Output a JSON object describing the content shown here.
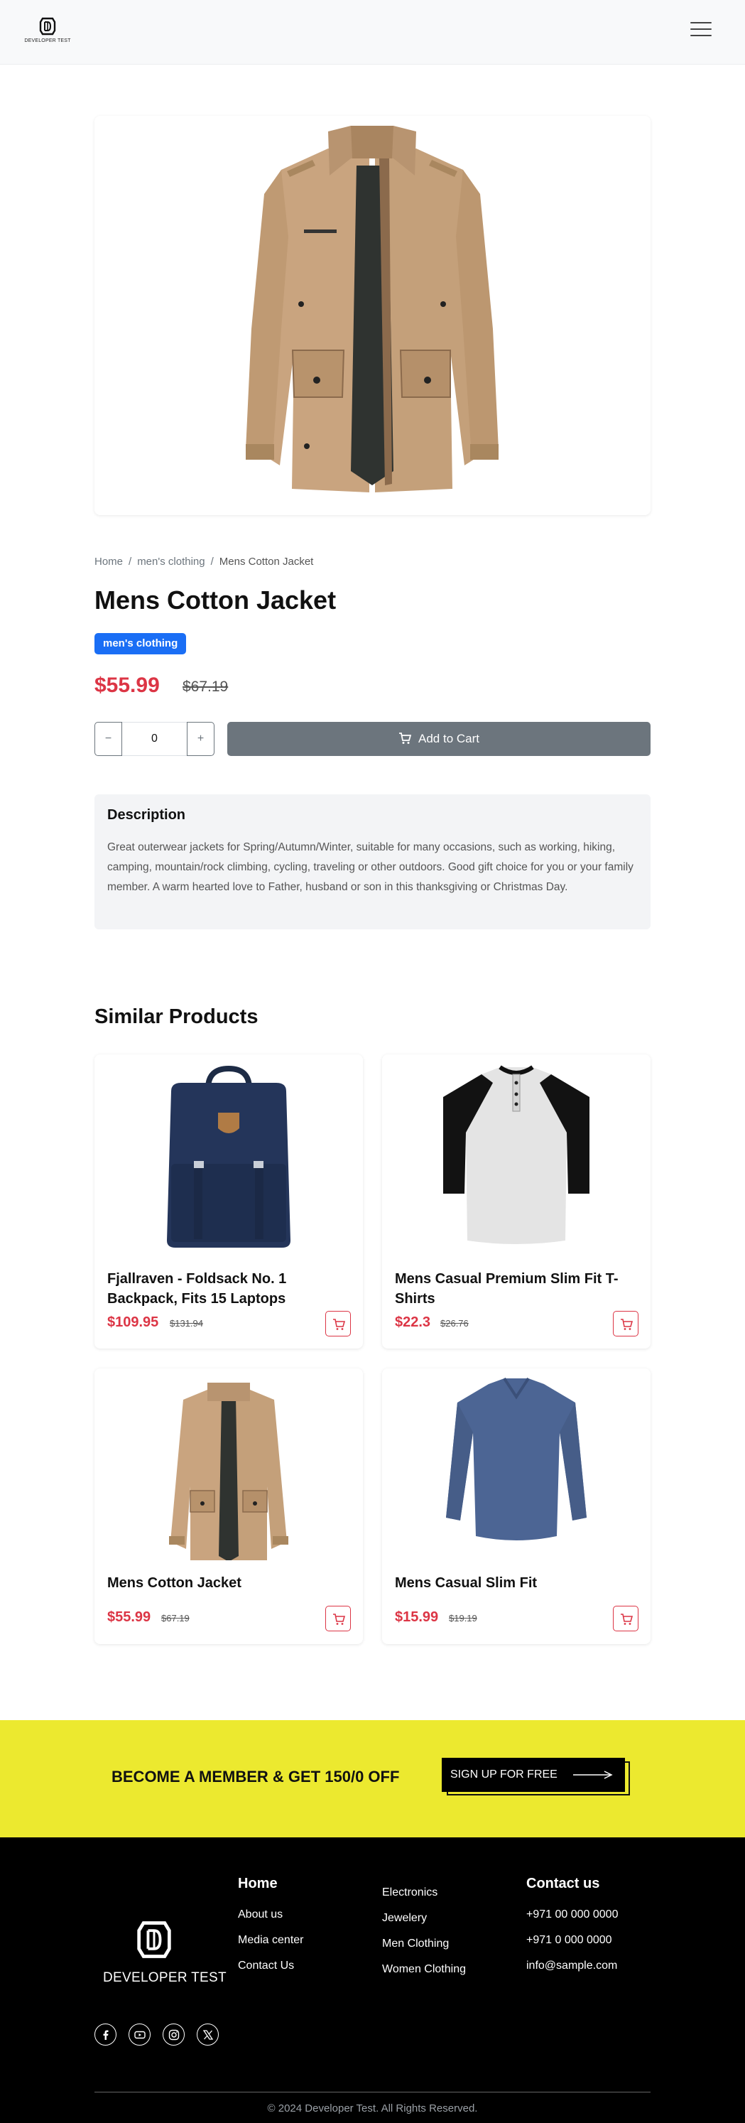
{
  "header": {
    "logo_text": "DEVELOPER TEST"
  },
  "breadcrumb": {
    "home": "Home",
    "category": "men's clothing",
    "current": "Mens Cotton Jacket"
  },
  "product": {
    "title": "Mens Cotton Jacket",
    "category_badge": "men's clothing",
    "price": "$55.99",
    "old_price": "$67.19",
    "quantity": "0",
    "minus_label": "−",
    "plus_label": "+",
    "add_to_cart_label": "Add to Cart",
    "description_heading": "Description",
    "description": "Great outerwear jackets for Spring/Autumn/Winter, suitable for many occasions, such as working, hiking, camping, mountain/rock climbing, cycling, traveling or other outdoors. Good gift choice for you or your family member. A warm hearted love to Father, husband or son in this thanksgiving or Christmas Day."
  },
  "similar": {
    "heading": "Similar Products",
    "items": [
      {
        "title": "Fjallraven - Foldsack No. 1 Backpack, Fits 15 Laptops",
        "price": "$109.95",
        "old_price": "$131.94",
        "image": "backpack"
      },
      {
        "title": "Mens Casual Premium Slim Fit T-Shirts",
        "price": "$22.3",
        "old_price": "$26.76",
        "image": "raglan-tshirt"
      },
      {
        "title": "Mens Cotton Jacket",
        "price": "$55.99",
        "old_price": "$67.19",
        "image": "cotton-jacket"
      },
      {
        "title": "Mens Casual Slim Fit",
        "price": "$15.99",
        "old_price": "$19.19",
        "image": "longsleeve-tshirt"
      }
    ]
  },
  "banner": {
    "text": "BECOME A MEMBER & GET 150/0 OFF",
    "button_label": "SIGN UP FOR FREE"
  },
  "footer": {
    "logo_text": "DEVELOPER TEST",
    "col1": {
      "heading": "Home",
      "links": [
        "About us",
        "Media center",
        "Contact Us"
      ]
    },
    "col2": {
      "links": [
        "Electronics",
        "Jewelery",
        "Men Clothing",
        "Women Clothing"
      ]
    },
    "col3": {
      "heading": "Contact us",
      "links": [
        "+971 00 000 0000",
        "+971 0 000 0000",
        "info@sample.com"
      ]
    },
    "socials": [
      "facebook-icon",
      "youtube-icon",
      "instagram-icon",
      "x-icon"
    ],
    "copyright": "© 2024 Developer Test. All Rights Reserved."
  },
  "colors": {
    "accent_red": "#dc3545",
    "badge_blue": "#1a6ef5",
    "banner_yellow": "#ece92f",
    "button_gray": "#6c757d"
  }
}
